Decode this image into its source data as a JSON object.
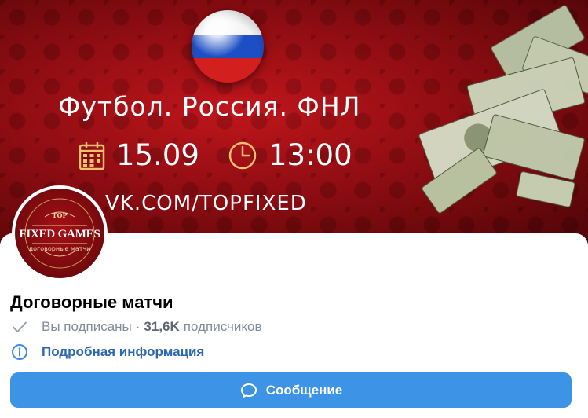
{
  "cover": {
    "title": "Футбол. Россия. ФНЛ",
    "date": "15.09",
    "time": "13:00",
    "url": "VK.COM/TOPFIXED",
    "icons": [
      "russia-flag-icon",
      "calendar-icon",
      "clock-icon"
    ],
    "colors": {
      "background": "#a8121a",
      "accent_gold": "#f0c070"
    }
  },
  "avatar": {
    "top_label": "TOP",
    "main_label": "FIXED GAMES",
    "sub_label": "договорные матчи"
  },
  "group": {
    "name": "Договорные матчи",
    "subscription_status": "Вы подписаны",
    "separator": "·",
    "subscribers_count": "31,6K",
    "subscribers_label": "подписчиков"
  },
  "info": {
    "link_label": "Подробная информация"
  },
  "actions": {
    "message_label": "Сообщение"
  },
  "colors": {
    "button_bg": "#3d93e6",
    "link": "#2b66b0",
    "secondary_text": "#818c99"
  }
}
